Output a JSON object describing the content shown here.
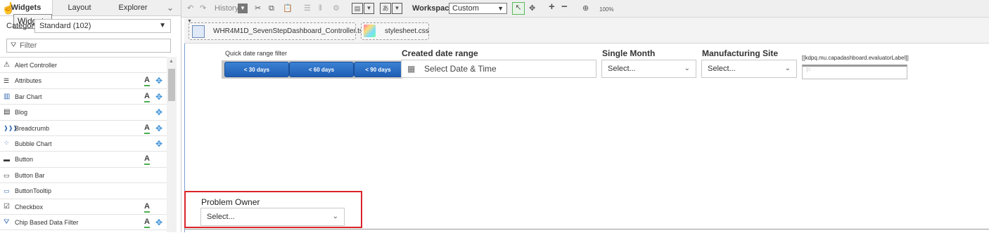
{
  "left_panel": {
    "tabs": [
      {
        "label": "Widgets",
        "active": true
      },
      {
        "label": "Layout",
        "active": false
      },
      {
        "label": "Explorer",
        "active": false
      }
    ],
    "tooltip": "Widgets",
    "category_label": "Category",
    "category_value": "Standard (102)",
    "filter_placeholder": "Filter",
    "widgets": [
      {
        "label": "Alert Controller",
        "icon": "alert-icon",
        "a": false,
        "move": false
      },
      {
        "label": "Attributes",
        "icon": "attributes-icon",
        "a": true,
        "move": true
      },
      {
        "label": "Bar Chart",
        "icon": "bar-chart-icon",
        "a": true,
        "move": true
      },
      {
        "label": "Blog",
        "icon": "blog-icon",
        "a": false,
        "move": true
      },
      {
        "label": "Breadcrumb",
        "icon": "breadcrumb-icon",
        "a": true,
        "move": true
      },
      {
        "label": "Bubble Chart",
        "icon": "bubble-chart-icon",
        "a": false,
        "move": true
      },
      {
        "label": "Button",
        "icon": "button-icon",
        "a": true,
        "move": false
      },
      {
        "label": "Button Bar",
        "icon": "button-bar-icon",
        "a": false,
        "move": false
      },
      {
        "label": "ButtonTooltip",
        "icon": "button-tooltip-icon",
        "a": false,
        "move": false
      },
      {
        "label": "Checkbox",
        "icon": "checkbox-icon",
        "a": true,
        "move": false
      },
      {
        "label": "Chip Based Data Filter",
        "icon": "filter-icon",
        "a": true,
        "move": true
      }
    ]
  },
  "toolbar": {
    "history_label": "History",
    "workspace_label": "Workspace",
    "workspace_value": "Custom",
    "zoom": "100%"
  },
  "file_tabs": [
    {
      "label": "WHR4M1D_SevenStepDashboard_Controller.ts"
    },
    {
      "label": "stylesheet.css"
    }
  ],
  "canvas": {
    "quick_filter": {
      "label": "Quick date range filter",
      "buttons": [
        "< 30 days",
        "< 60 days",
        "< 90 days"
      ]
    },
    "created_date": {
      "label": "Created date range",
      "placeholder": "Select Date & Time"
    },
    "single_month": {
      "label": "Single Month",
      "value": "Select..."
    },
    "manufacturing_site": {
      "label": "Manufacturing Site",
      "value": "Select..."
    },
    "evaluator": {
      "label": "[[kdpq.mu.capadashboard.evaluatorLabel]]"
    },
    "problem_owner": {
      "label": "Problem Owner",
      "value": "Select..."
    }
  },
  "colors": {
    "accent": "#1f5fb5",
    "highlight_border": "#d9252a",
    "selected_tool": "#5cb85c"
  }
}
